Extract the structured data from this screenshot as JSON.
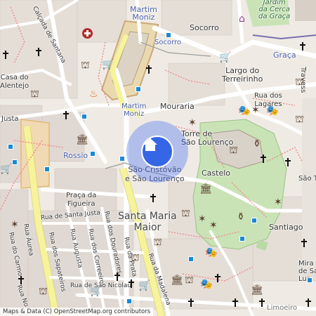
{
  "map": {
    "attribution": "Maps & Data (C) OpenStreetMap.org contributors",
    "accent_color": "#3566e6",
    "labels": {
      "martim_moniz_top": "Martim\nMoniz",
      "martim_moniz_mid": "Martim\nMoniz",
      "socorro_a": "Socorro",
      "socorro_b": "Socorro",
      "jardim": "Jardim\nda Cerca\nda Graça",
      "graca": "Graça",
      "largo_terreirinho": "Largo do\nTerreirinho",
      "rua_lagares": "Rua dos\nLagares",
      "calcada_santana": "Calçada de Santana",
      "casa_alentejo": "Casa do\nAlentejo",
      "mouraria": "Mouraria",
      "justa": "Justa",
      "rossio": "Rossio",
      "torre": "Torre de\nSão Lourenço",
      "sao_cristovao": "São Cristóvão\ne São Lourenço",
      "castelo": "Castelo",
      "praca_figueira": "Praça da\nFigueira",
      "rua_santa_justa": "Rua de Santa Justa",
      "santa_maria_maior": "Santa Maria\nMaior",
      "santiago": "Santiago",
      "rua_aurea": "Rua Áurea",
      "rua_carmo": "Rua do Carmo",
      "rua_sapateiros": "Rua dos Sapateiros",
      "rua_augusta": "Rua Augusta",
      "rua_correeiros": "Rua dos Correeiros",
      "rua_douradores": "Rua dos Douradores",
      "rua_madalena": "Rua da Madalena",
      "rua_prata": "Rua da Prata",
      "rua_nicolau": "Rua de São Nicolau",
      "mira": "Mira\nde Sa\nLuz",
      "sao_t": "São T",
      "travesse": "Travess",
      "limoeiro": "Limoeiro",
      "rua_no": "Rua No"
    },
    "location_marker_icon": "home-icon"
  }
}
